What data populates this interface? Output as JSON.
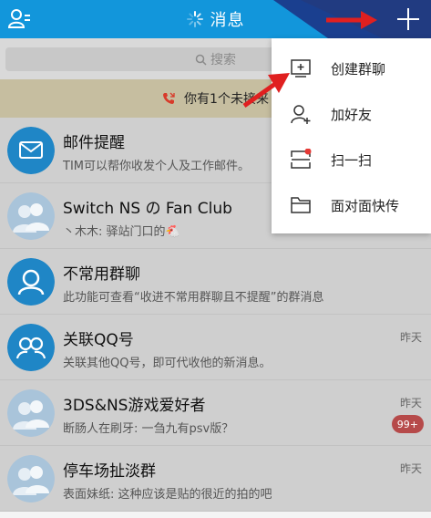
{
  "header": {
    "title": "消息"
  },
  "search": {
    "placeholder": "搜索"
  },
  "missed_call": {
    "text": "你有1个未接来"
  },
  "menu": {
    "items": [
      {
        "label": "创建群聊",
        "icon": "create-group-icon"
      },
      {
        "label": "加好友",
        "icon": "add-friend-icon"
      },
      {
        "label": "扫一扫",
        "icon": "scan-icon"
      },
      {
        "label": "面对面快传",
        "icon": "folder-icon"
      }
    ]
  },
  "conversations": [
    {
      "name": "邮件提醒",
      "preview": "TIM可以帮你收发个人及工作邮件。",
      "time": "",
      "badge": "",
      "avatar": "mail-icon"
    },
    {
      "name": "Switch NS の Fan Club",
      "preview": "丶木木: 驿站门口的🐔",
      "time": "",
      "badge": "",
      "avatar": "group-avatar-icon"
    },
    {
      "name": "不常用群聊",
      "preview": "此功能可查看“收进不常用群聊且不提醒”的群消息",
      "time": "",
      "badge": "",
      "avatar": "folded-group-icon"
    },
    {
      "name": "关联QQ号",
      "preview": "关联其他QQ号，即可代收他的新消息。",
      "time": "昨天",
      "badge": "",
      "avatar": "link-qq-icon"
    },
    {
      "name": "3DS&NS游戏爱好者",
      "preview": "断肠人在刷牙: 一刍九有psv版？",
      "time": "昨天",
      "badge": "99+",
      "avatar": "group-avatar-icon"
    },
    {
      "name": "停车场扯淡群",
      "preview": "表面妹纸: 这种应该是贴的很近的拍的吧",
      "time": "昨天",
      "badge": "",
      "avatar": "group-avatar-icon"
    }
  ],
  "colors": {
    "header": "#1296db",
    "accent": "#e02020",
    "badge": "#b64a4a"
  }
}
